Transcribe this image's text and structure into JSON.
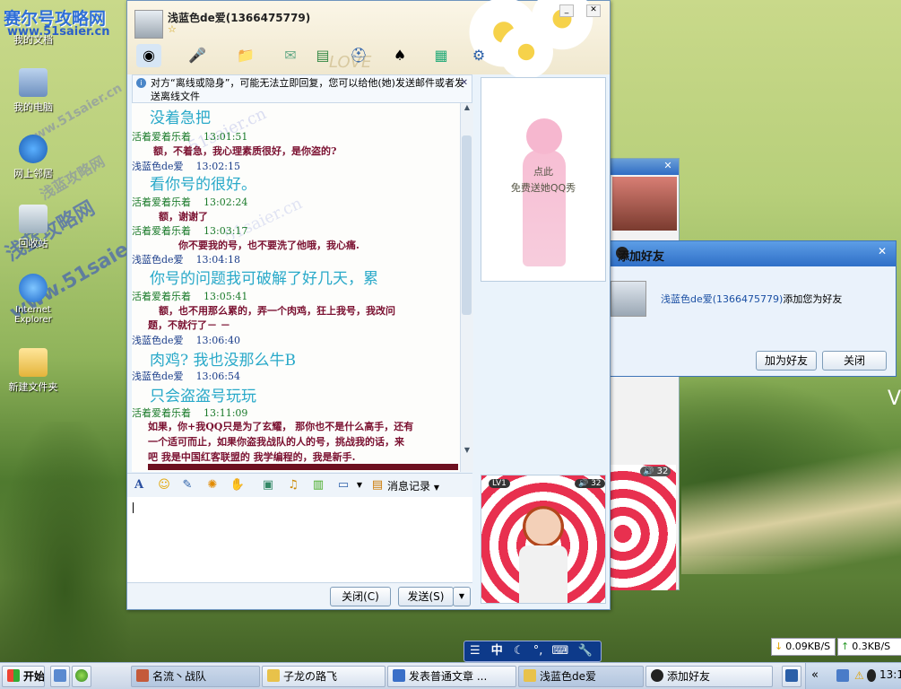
{
  "watermarks": {
    "top_left": "赛尔号攻略网",
    "url": "www.51saier.cn",
    "side_a": "浅蓝攻略网",
    "side_b": "www.51saier.cn",
    "side_c": "浅蓝攻略网",
    "side_d": "www.51saier.cn",
    "chat_a": "51saier.cn",
    "chat_b": "51saier.cn"
  },
  "desktop": {
    "icons": [
      {
        "label": "我的文档"
      },
      {
        "label": "我的电脑"
      },
      {
        "label": "网上邻居"
      },
      {
        "label": "回收站"
      },
      {
        "label": "Internet\nExplorer"
      },
      {
        "label": "新建文件夹"
      }
    ]
  },
  "chat_window": {
    "title": "浅蓝色de爱(1366475779)",
    "star": "☆",
    "lover_text": "LOVE",
    "notice": "对方“离线或隐身”，可能无法立即回复，您可以给他(她)发送邮件或者发送离线文件",
    "notice_link1": "发送邮件",
    "notice_link2": "发送离线文件",
    "messages": [
      {
        "kind": "big",
        "text": "没着急把"
      },
      {
        "kind": "sender",
        "name": "活着爱着乐着",
        "time": "13:01:51"
      },
      {
        "kind": "red",
        "text": "额，不着急，我心理素质很好，是你盗的?"
      },
      {
        "kind": "sender_me",
        "name": "浅蓝色de爱",
        "time": "13:02:15"
      },
      {
        "kind": "big",
        "text": "看你号的很好。"
      },
      {
        "kind": "sender",
        "name": "活着爱着乐着",
        "time": "13:02:24"
      },
      {
        "kind": "red",
        "text": "额，谢谢了"
      },
      {
        "kind": "sender",
        "name": "活着爱着乐着",
        "time": "13:03:17"
      },
      {
        "kind": "red",
        "text": "你不要我的号，也不要洗了他哦，我心痛."
      },
      {
        "kind": "sender_me",
        "name": "浅蓝色de爱",
        "time": "13:04:18"
      },
      {
        "kind": "big",
        "text": "你号的问题我可破解了好几天，累"
      },
      {
        "kind": "sender",
        "name": "活着爱着乐着",
        "time": "13:05:41"
      },
      {
        "kind": "red",
        "text": "额，也不用那么累的，弄一个肉鸡，狂上我号，我改问"
      },
      {
        "kind": "red",
        "text": "题，不就行了－ －"
      },
      {
        "kind": "sender_me",
        "name": "浅蓝色de爱",
        "time": "13:06:40"
      },
      {
        "kind": "big",
        "text": "肉鸡? 我也没那么牛B"
      },
      {
        "kind": "sender_me",
        "name": "浅蓝色de爱",
        "time": "13:06:54"
      },
      {
        "kind": "big",
        "text": "只会盗盗号玩玩"
      },
      {
        "kind": "sender",
        "name": "活着爱着乐着",
        "time": "13:11:09"
      },
      {
        "kind": "red",
        "text": "如果，你+我QQ只是为了玄耀，  那你也不是什么高手，还有"
      },
      {
        "kind": "red",
        "text": "一个适可而止，如果你盗我战队的人的号，挑战我的话，来"
      },
      {
        "kind": "red",
        "text": "吧   我是中国红客联盟的 我学编程的，我是新手."
      }
    ],
    "show_panel": {
      "line1": "点此",
      "line2": "免费送她QQ秀"
    },
    "format_bar": {
      "history_label": "消息记录"
    },
    "buttons": {
      "close": "关闭(C)",
      "send": "发送(S)"
    },
    "doll_level": "LV1",
    "doll_volume": "32"
  },
  "add_friend": {
    "title": "添加好友",
    "message_user": "浅蓝色de爱(1366475779)",
    "message_suffix": "添加您为好友",
    "add_button": "加为好友",
    "close_button": "关闭",
    "doll_volume": "32"
  },
  "ime_bar": {
    "label": "中"
  },
  "net_speed": {
    "down": "0.09KB/S",
    "up": "0.3KB/S"
  },
  "desktop_letter": "V",
  "taskbar": {
    "start": "开始",
    "tasks": [
      {
        "label": "名流丶战队"
      },
      {
        "label": "子龙の路飞"
      },
      {
        "label": "发表普通文章 ..."
      },
      {
        "label": "浅蓝色de爱"
      },
      {
        "label": "添加好友"
      }
    ],
    "tray_chevron": "«",
    "clock": "13:1"
  }
}
